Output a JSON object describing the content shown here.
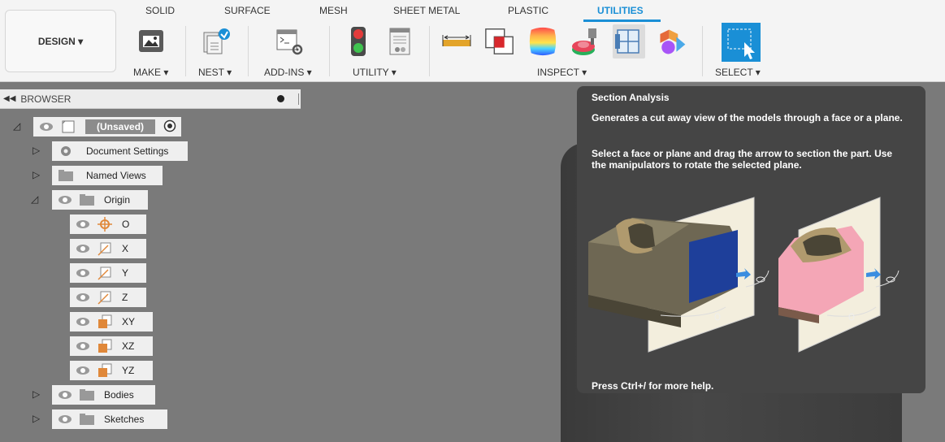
{
  "toolbar": {
    "design_label": "DESIGN ▾",
    "tabs": [
      {
        "label": "SOLID"
      },
      {
        "label": "SURFACE"
      },
      {
        "label": "MESH"
      },
      {
        "label": "SHEET METAL"
      },
      {
        "label": "PLASTIC"
      },
      {
        "label": "UTILITIES"
      }
    ],
    "active_tab": "UTILITIES",
    "groups": [
      {
        "label": "MAKE ▾"
      },
      {
        "label": "NEST ▾"
      },
      {
        "label": "ADD-INS ▾"
      },
      {
        "label": "UTILITY ▾"
      },
      {
        "label": "INSPECT ▾"
      },
      {
        "label": "SELECT ▾"
      }
    ]
  },
  "browser": {
    "title": "BROWSER",
    "items": [
      {
        "label": "(Unsaved)"
      },
      {
        "label": "Document Settings"
      },
      {
        "label": "Named Views"
      },
      {
        "label": "Origin"
      },
      {
        "label": "O"
      },
      {
        "label": "X"
      },
      {
        "label": "Y"
      },
      {
        "label": "Z"
      },
      {
        "label": "XY"
      },
      {
        "label": "XZ"
      },
      {
        "label": "YZ"
      },
      {
        "label": "Bodies"
      },
      {
        "label": "Sketches"
      }
    ]
  },
  "tooltip": {
    "title": "Section Analysis",
    "p1": "Generates a cut away view of the models through a face or a plane.",
    "p2": "Select a face or plane and drag the arrow to section the part. Use the manipulators to rotate the selected plane.",
    "footer": "Press Ctrl+/ for more help."
  },
  "colors": {
    "accent": "#1a8fd6",
    "tooltip_bg": "#454545",
    "viewport_bg": "#7a7a7a"
  }
}
